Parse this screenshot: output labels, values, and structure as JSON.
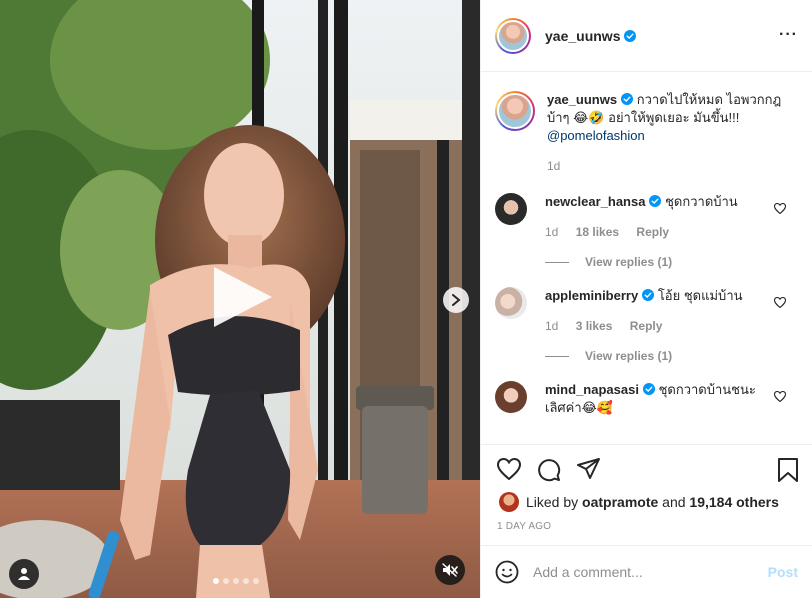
{
  "post": {
    "username": "yae_uunws",
    "caption_text": "กวาดไปให้หมด ไอพวกกฎ บ้าๆ 😂🤣 อย่าให้พูดเยอะ มันขึ้น!!!",
    "caption_mention": "@pomelofashion",
    "caption_age": "1d",
    "more_icon": "more-options-icon",
    "colors": {
      "verified": "#0095f6",
      "link": "#00376b",
      "muted": "#8e8e8e",
      "post_disabled": "#b2dffc"
    }
  },
  "media": {
    "carousel_count": 5,
    "carousel_active": 0,
    "icons": {
      "play": "play-icon",
      "next": "chevron-right-icon",
      "tag": "user-tag-icon",
      "mute": "speaker-muted-icon"
    }
  },
  "comments": [
    {
      "username": "newclear_hansa",
      "text": "ชุดกวาดบ้าน",
      "age": "1d",
      "likes": "18 likes",
      "reply": "Reply",
      "view_replies": "View replies (1)"
    },
    {
      "username": "appleminiberry",
      "text": "โอ้ย ชุดแม่บ้าน",
      "age": "1d",
      "likes": "3 likes",
      "reply": "Reply",
      "view_replies": "View replies (1)"
    },
    {
      "username": "mind_napasasi",
      "text": "ชุดกวาดบ้านชนะเลิศค่า😂🥰",
      "age": "",
      "likes": "",
      "reply": "",
      "view_replies": ""
    }
  ],
  "actions": {
    "liked_by_prefix": "Liked by",
    "liked_by_user": "oatpramote",
    "liked_by_and": "and",
    "liked_by_others": "19,184 others",
    "timestamp": "1 DAY AGO"
  },
  "composer": {
    "placeholder": "Add a comment...",
    "post_label": "Post"
  }
}
